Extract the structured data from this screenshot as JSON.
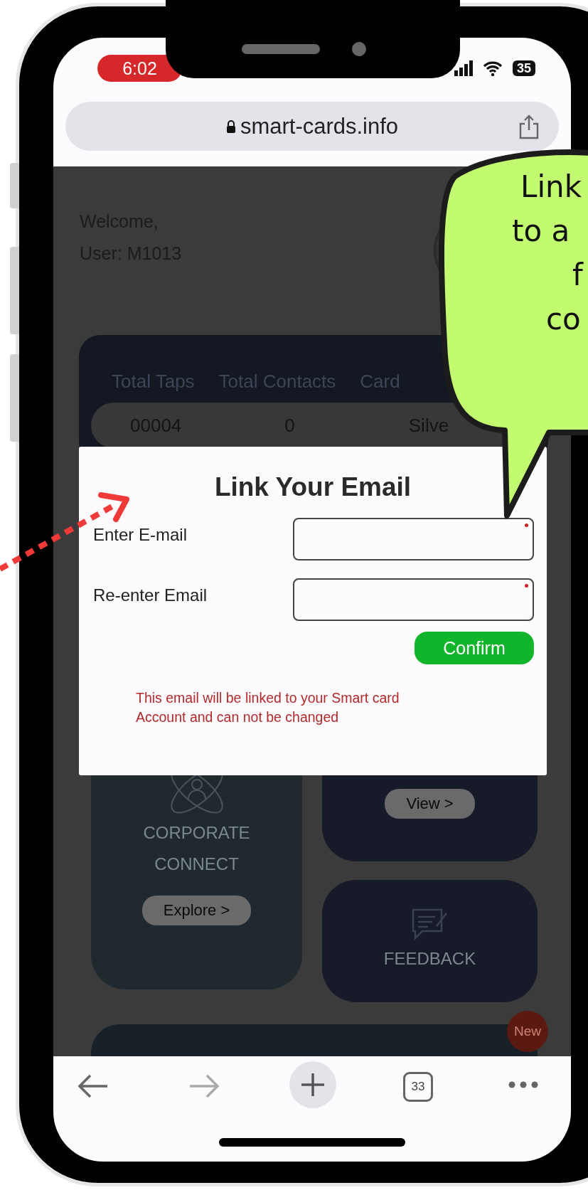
{
  "status_bar": {
    "time": "6:02",
    "battery": "35"
  },
  "browser": {
    "url": "smart-cards.info",
    "tab_count": "33"
  },
  "page": {
    "welcome": "Welcome,",
    "user": "User: M1013",
    "stats": {
      "columns": [
        "Total Taps",
        "Total Contacts",
        "Card"
      ],
      "values": [
        "00004",
        "0",
        "Silve"
      ]
    },
    "tiles": [
      {
        "kind": "corporate",
        "title_lines": [
          "CORPORATE",
          "CONNECT"
        ],
        "button": "Explore >"
      },
      {
        "kind": "view",
        "button": "View >"
      },
      {
        "kind": "feedback",
        "title": "FEEDBACK"
      }
    ],
    "badge": "New"
  },
  "modal": {
    "title": "Link Your Email",
    "fields": [
      {
        "label": "Enter E-mail",
        "required": true
      },
      {
        "label": "Re-enter Email",
        "required": true
      }
    ],
    "confirm": "Confirm",
    "note": "This email will be linked to your Smart card Account and can not be changed"
  },
  "callout": {
    "lines": [
      "Link",
      "to a",
      "f",
      "co"
    ]
  }
}
